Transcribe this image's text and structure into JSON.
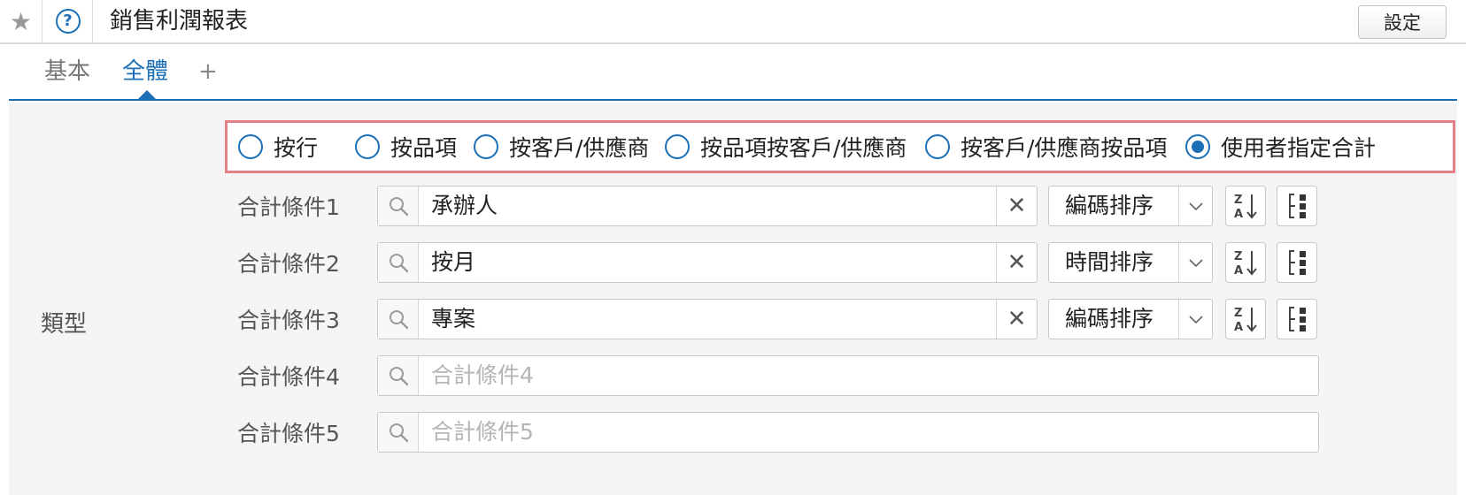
{
  "header": {
    "title": "銷售利潤報表",
    "settings_label": "設定"
  },
  "tabs": [
    {
      "label": "基本"
    },
    {
      "label": "全體"
    },
    {
      "label": "+"
    }
  ],
  "type_label": "類型",
  "radios": [
    {
      "label": "按行",
      "checked": false
    },
    {
      "label": "按品項",
      "checked": false
    },
    {
      "label": "按客戶/供應商",
      "checked": false
    },
    {
      "label": "按品項按客戶/供應商",
      "checked": false
    },
    {
      "label": "按客戶/供應商按品項",
      "checked": false
    },
    {
      "label": "使用者指定合計",
      "checked": true
    }
  ],
  "conditions": [
    {
      "label": "合計條件1",
      "value": "承辦人",
      "sort": "編碼排序"
    },
    {
      "label": "合計條件2",
      "value": "按月",
      "sort": "時間排序"
    },
    {
      "label": "合計條件3",
      "value": "專案",
      "sort": "編碼排序"
    },
    {
      "label": "合計條件4",
      "placeholder": "合計條件4"
    },
    {
      "label": "合計條件5",
      "placeholder": "合計條件5"
    }
  ],
  "colors": {
    "accent": "#1d6fb5",
    "highlight_border": "#e57f88"
  }
}
